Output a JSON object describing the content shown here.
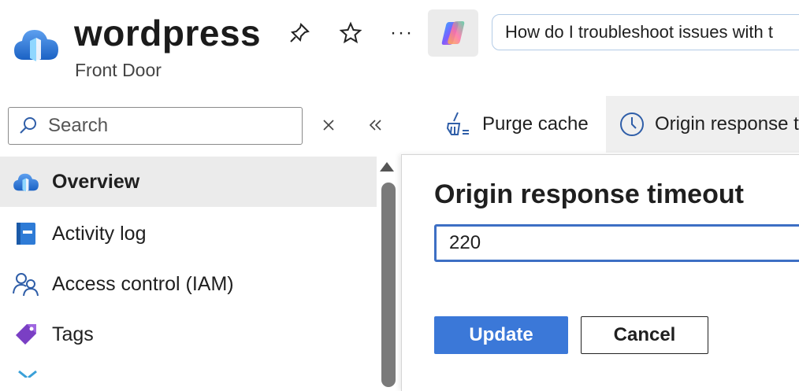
{
  "header": {
    "title": "wordpress",
    "subtitle": "Front Door",
    "icons": [
      "pin-icon",
      "star-icon",
      "more-icon",
      "copilot-icon"
    ],
    "copilot_prompt": "How do I troubleshoot issues with t"
  },
  "sidebar": {
    "search": {
      "placeholder": "Search",
      "value": ""
    },
    "items": [
      {
        "label": "Overview",
        "icon": "front-door-icon",
        "active": true
      },
      {
        "label": "Activity log",
        "icon": "activity-log-icon",
        "active": false
      },
      {
        "label": "Access control (IAM)",
        "icon": "people-icon",
        "active": false
      },
      {
        "label": "Tags",
        "icon": "tag-icon",
        "active": false
      }
    ]
  },
  "toolbar": {
    "purge_label": "Purge cache",
    "origin_label": "Origin response timeout"
  },
  "flyout": {
    "title": "Origin response timeout",
    "value": "220",
    "update_label": "Update",
    "cancel_label": "Cancel"
  },
  "colors": {
    "accent": "#3b78d8",
    "input_focus": "#3d6fc4",
    "nav_active": "#ebebeb"
  }
}
